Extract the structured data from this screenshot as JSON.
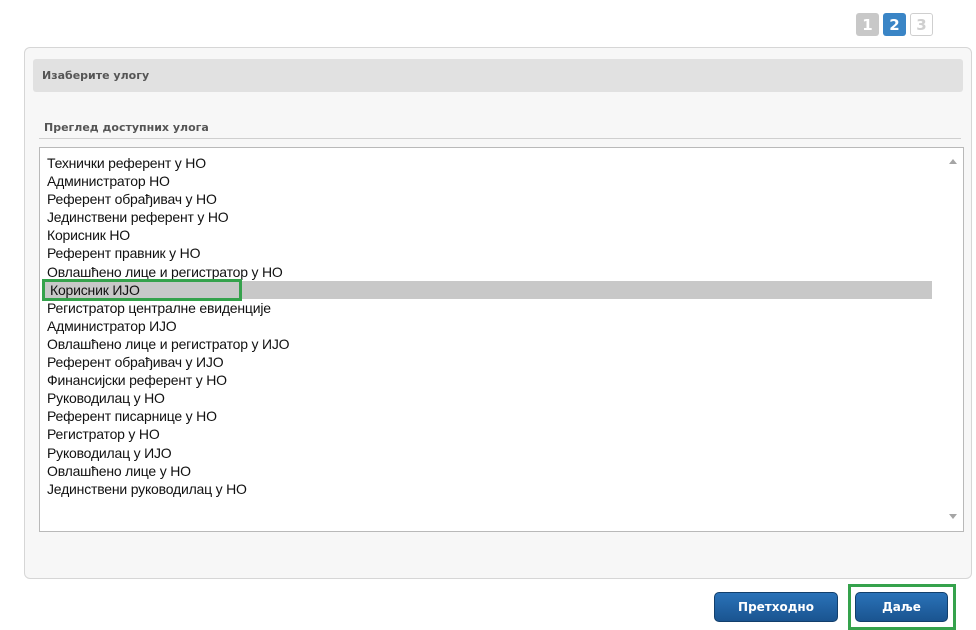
{
  "wizard": {
    "steps": [
      {
        "label": "1",
        "state": "done"
      },
      {
        "label": "2",
        "state": "active"
      },
      {
        "label": "3",
        "state": "todo"
      }
    ]
  },
  "panel": {
    "header": "Изаберите улогу",
    "section_title": "Преглед доступних улога"
  },
  "roles": [
    "Технички референт у НО",
    "Администратор НО",
    "Референт обрађивач у НО",
    "Јединствени референт у НО",
    "Корисник НО",
    "Референт правник у НО",
    "Овлашћено лице и регистратор у НО",
    "Корисник ИЈО",
    "Регистратор централне евиденције",
    "Администратор ИЈО",
    "Овлашћено лице и регистратор у ИЈО",
    "Референт обрађивач у ИЈО",
    "Финансијски референт у НО",
    "Руководилац у НО",
    "Референт писарнице у НО",
    "Регистратор у НО",
    "Руководилац у ИЈО",
    "Овлашћено лице у НО",
    "Јединствени руководилац у НО"
  ],
  "selected_role": "Корисник ИЈО",
  "buttons": {
    "previous": "Претходно",
    "next": "Даље"
  },
  "colors": {
    "accent_blue": "#1f63a4",
    "step_active": "#3a85c6",
    "highlight_green": "#35a24c",
    "selected_row": "#c8c8c8"
  }
}
